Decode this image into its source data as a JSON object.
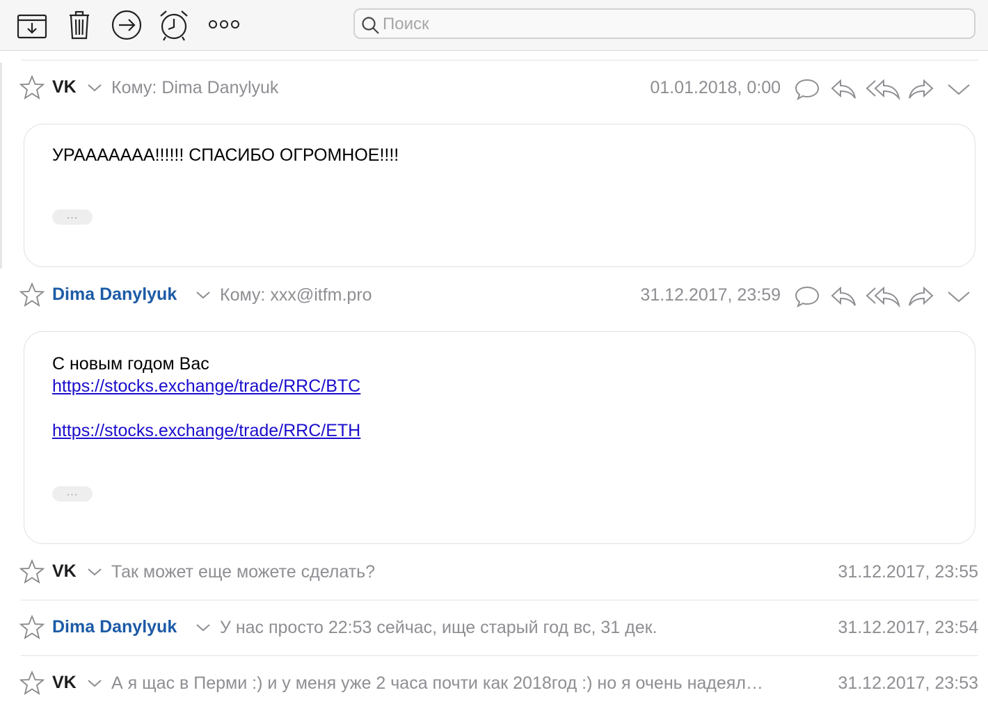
{
  "toolbar": {
    "icons": [
      "archive-icon",
      "trash-icon",
      "move-icon",
      "remind-icon",
      "more-icon"
    ],
    "search_placeholder": "Поиск"
  },
  "messages": [
    {
      "sender": "VK",
      "recipient": "Кому: Dima Danylyuk",
      "date": "01.01.2018, 0:00",
      "body": "УРААААААА!!!!!! СПАСИБО ОГРОМНОЕ!!!!",
      "more": "..."
    },
    {
      "sender": "Dima Danylyuk",
      "recipient": "Кому: xxx@itfm.pro",
      "date": "31.12.2017, 23:59",
      "body_line": "С новым годом Вас",
      "link1": "https://stocks.exchange/trade/RRC/BTC",
      "link2": "https://stocks.exchange/trade/RRC/ETH",
      "more": "..."
    }
  ],
  "collapsed": [
    {
      "sender": "VK",
      "snippet": "Так может еще можете сделать?",
      "date": "31.12.2017, 23:55"
    },
    {
      "sender": "Dima Danylyuk",
      "snippet": "У нас просто 22:53 сейчас, ище старый год вс, 31 дек.",
      "date": "31.12.2017, 23:54"
    },
    {
      "sender": "VK",
      "snippet": "А я щас в Перми :) и у меня уже 2 часа почти как 2018год :) но я очень надеял…",
      "date": "31.12.2017, 23:53"
    }
  ],
  "colors": {
    "dima_sender": "#1c5aa6",
    "link": "#1a0dcc",
    "muted": "#8e8e93"
  }
}
